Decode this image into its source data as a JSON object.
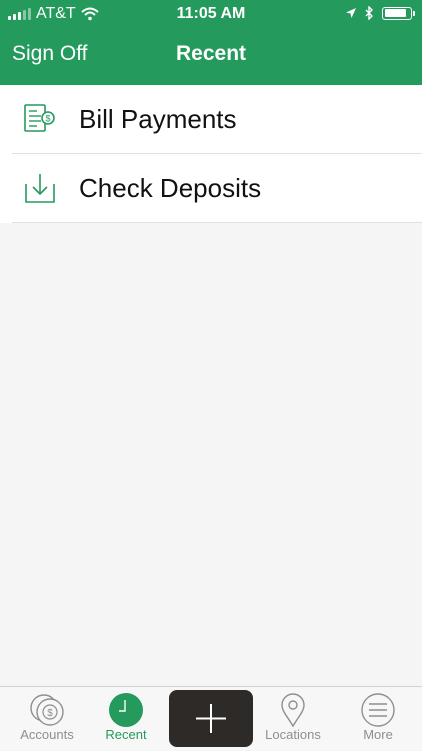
{
  "status_bar": {
    "carrier": "AT&T",
    "time": "11:05 AM",
    "battery_level": 0.85
  },
  "nav": {
    "left_label": "Sign Off",
    "title": "Recent"
  },
  "list": {
    "items": [
      {
        "label": "Bill Payments",
        "icon": "bill-document-icon"
      },
      {
        "label": "Check Deposits",
        "icon": "download-tray-icon"
      }
    ]
  },
  "tab_bar": {
    "tabs": [
      {
        "label": "Accounts",
        "icon": "dollar-coin-icon",
        "active": false
      },
      {
        "label": "Recent",
        "icon": "clock-icon",
        "active": true
      },
      {
        "label": "",
        "icon": "plus-icon",
        "active": false
      },
      {
        "label": "Locations",
        "icon": "map-pin-icon",
        "active": false
      },
      {
        "label": "More",
        "icon": "hamburger-menu-icon",
        "active": false
      }
    ]
  },
  "colors": {
    "brand_green": "#249a5c",
    "center_button": "#2e2a27",
    "background": "#f5f5f5"
  }
}
